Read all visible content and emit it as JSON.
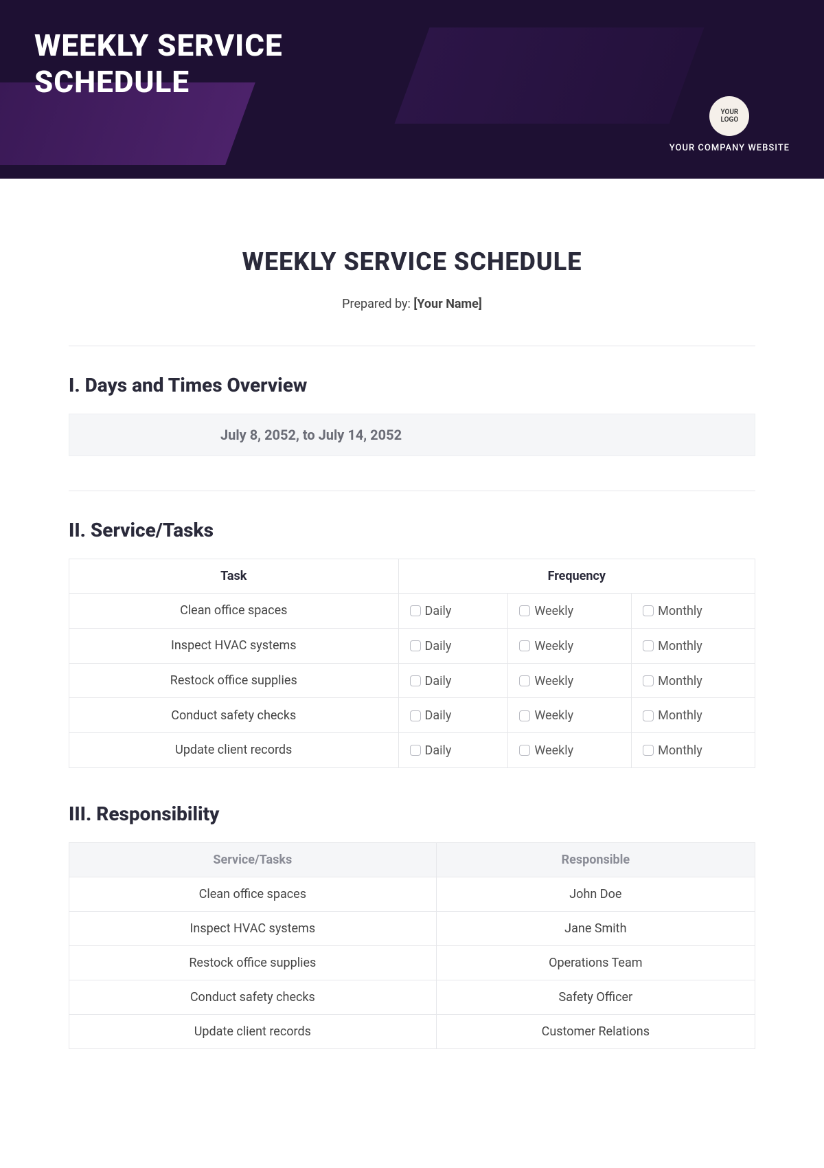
{
  "banner": {
    "title_line1": "WEEKLY SERVICE",
    "title_line2": "SCHEDULE",
    "logo_text": "YOUR\nLOGO",
    "company_website": "YOUR COMPANY WEBSITE"
  },
  "doc": {
    "title": "WEEKLY SERVICE SCHEDULE",
    "prepared_label": "Prepared by: ",
    "prepared_value": "[Your Name]"
  },
  "section1": {
    "heading": "I. Days and Times Overview",
    "date_range": "July 8, 2052, to July 14, 2052"
  },
  "section2": {
    "heading": "II. Service/Tasks",
    "col_task": "Task",
    "col_frequency": "Frequency",
    "freq_labels": {
      "daily": "Daily",
      "weekly": "Weekly",
      "monthly": "Monthly"
    },
    "tasks": [
      "Clean office spaces",
      "Inspect HVAC systems",
      "Restock office supplies",
      "Conduct safety checks",
      "Update client records"
    ]
  },
  "section3": {
    "heading": "III. Responsibility",
    "col_service": "Service/Tasks",
    "col_responsible": "Responsible",
    "rows": [
      {
        "task": "Clean office spaces",
        "responsible": "John Doe"
      },
      {
        "task": "Inspect HVAC systems",
        "responsible": "Jane Smith"
      },
      {
        "task": "Restock office supplies",
        "responsible": "Operations Team"
      },
      {
        "task": "Conduct safety checks",
        "responsible": "Safety Officer"
      },
      {
        "task": "Update client records",
        "responsible": "Customer Relations"
      }
    ]
  }
}
